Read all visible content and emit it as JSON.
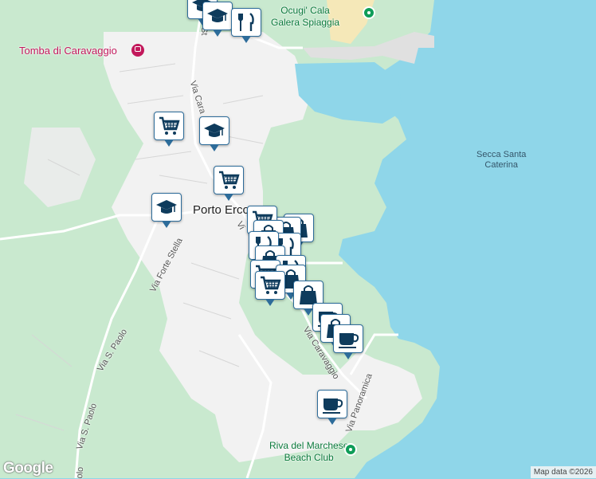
{
  "map": {
    "place_labels": {
      "town": "Porto Erco",
      "tomb": "Tomba di Caravaggio",
      "beach_top_line1": "Ocugi' Cala",
      "beach_top_line2": "Galera Spiaggia",
      "sea_line1": "Secca Santa",
      "sea_line2": "Caterina",
      "beach_bottom_line1": "Riva del Marchese",
      "beach_bottom_line2": "Beach Club"
    },
    "street_labels": {
      "via_forte_stella": "Via Forte Stella",
      "via_s_paolo_1": "Via S. Paolo",
      "via_s_paolo_2": "Via S. Paolo",
      "via_s_paolo_3": "olo",
      "via_caravaggio_top": "Via Cara",
      "via_caravaggio_bottom": "Via Caravaggio",
      "via_panoramica": "Via Panoramica",
      "via_short": "Vi",
      "str_fragment": "St"
    },
    "pins": [
      {
        "name": "restaurant-icon",
        "type": "restaurant"
      },
      {
        "name": "school-icon",
        "type": "school"
      },
      {
        "name": "shopping-cart-icon",
        "type": "cart"
      },
      {
        "name": "school-icon",
        "type": "school"
      },
      {
        "name": "shopping-cart-icon",
        "type": "cart"
      },
      {
        "name": "school-icon",
        "type": "school"
      },
      {
        "name": "shopping-bag-icon",
        "type": "bag"
      },
      {
        "name": "coffee-icon",
        "type": "coffee"
      },
      {
        "name": "coffee-icon",
        "type": "coffee"
      }
    ],
    "attribution": "Map data ©2026",
    "logo": "Google"
  }
}
